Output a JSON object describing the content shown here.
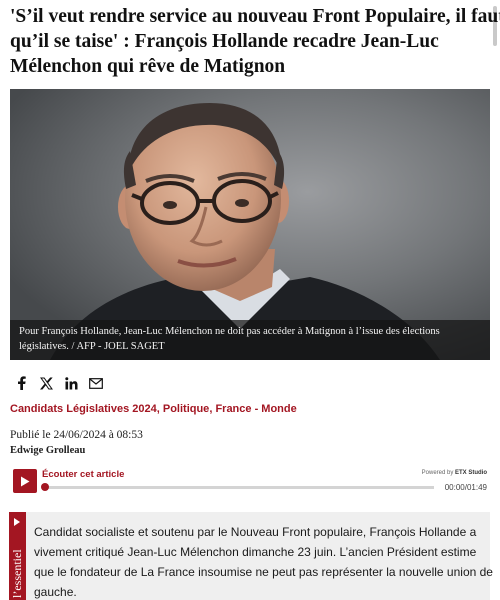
{
  "article": {
    "headline_lines": [
      "'S’il veut rendre service au nouveau Front Populaire, il faut",
      "qu’il se taise' : François Hollande recadre Jean-Luc",
      "Mélenchon qui rêve de Matignon"
    ],
    "photo": {
      "caption_lines": [
        "Pour François Hollande, Jean-Luc Mélenchon ne doit pas accéder à Matignon à l’issue des élections",
        "législatives.  / AFP - JOEL SAGET"
      ]
    },
    "share": [
      {
        "icon": "facebook-icon"
      },
      {
        "icon": "x-twitter-icon"
      },
      {
        "icon": "linkedin-icon"
      },
      {
        "icon": "email-icon"
      }
    ],
    "categories": [
      "Candidats Législatives 2024",
      "Politique",
      "France - Monde"
    ],
    "category_separator": ", ",
    "published": "Publié le 24/06/2024 à 08:53",
    "author": "Edwige Grolleau"
  },
  "audio_player": {
    "label": "Écouter cet article",
    "powered_by_prefix": "Powered by ",
    "powered_by_brand": "ETX Studio",
    "time": "00:00/01:49",
    "progress": 0,
    "accent_color": "#a31622"
  },
  "essentiel": {
    "tag": "l’essentiel",
    "lines": [
      "Candidat socialiste et soutenu par le Nouveau Front populaire, François Hollande a",
      "vivement critiqué Jean-Luc Mélenchon dimanche 23 juin. L’ancien Président estime",
      "que le fondateur de La France insoumise ne peut pas représenter la nouvelle union de",
      "gauche."
    ]
  }
}
